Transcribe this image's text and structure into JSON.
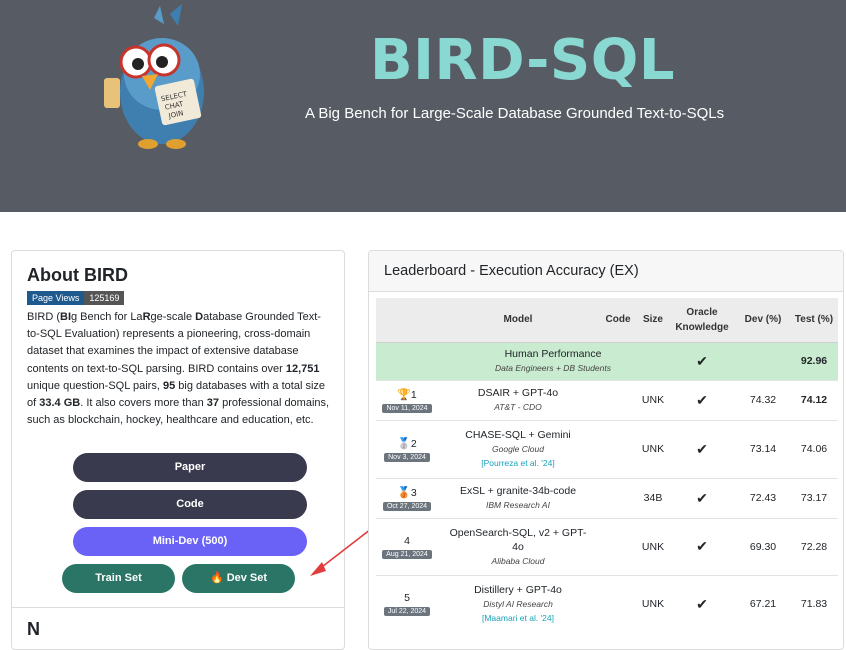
{
  "header": {
    "title": "BIRD-SQL",
    "subtitle": "A Big Bench for Large-Scale Database Grounded Text-to-SQLs",
    "mascot_sign": "SELECT CHAT JOIN"
  },
  "about": {
    "heading": "About BIRD",
    "badge_label": "Page Views",
    "badge_count": "125169",
    "p1": "BIRD (",
    "p1_b1": "BI",
    "p1_a": "g Bench for La",
    "p1_b2": "R",
    "p1_b": "ge-scale ",
    "p1_b3": "D",
    "p1_c": "atabase Grounded Text-to-SQL Evaluation) represents a pioneering, cross-domain dataset that examines the impact of extensive database contents on text-to-SQL parsing. BIRD contains over ",
    "n1": "12,751",
    "p2": " unique question-SQL pairs, ",
    "n2": "95",
    "p3": " big databases with a total size of ",
    "n3": "33.4 GB",
    "p4": ". It also covers more than ",
    "n4": "37",
    "p5": " professional domains, such as blockchain, hockey, healthcare and education, etc.",
    "buttons": {
      "paper": "Paper",
      "code": "Code",
      "minidev": "Mini-Dev (500)",
      "train": "Train Set",
      "dev": "🔥 Dev Set"
    },
    "next_heading": "N"
  },
  "leaderboard": {
    "title": "Leaderboard - Execution Accuracy (EX)",
    "columns": [
      "",
      "Model",
      "Code",
      "Size",
      "Oracle Knowledge",
      "Dev (%)",
      "Test (%)"
    ],
    "human": {
      "name": "Human Performance",
      "org": "Data Engineers + DB Students",
      "oracle": "✔",
      "test": "92.96"
    },
    "rows": [
      {
        "medal": "🏆",
        "rank": "1",
        "date": "Nov 11, 2024",
        "name": "DSAIR + GPT-4o",
        "org": "AT&T - CDO",
        "link": "",
        "code": "",
        "size": "UNK",
        "oracle": "✔",
        "dev": "74.32",
        "test": "74.12"
      },
      {
        "medal": "🥈",
        "rank": "2",
        "date": "Nov 3, 2024",
        "name": "CHASE-SQL + Gemini",
        "org": "Google Cloud",
        "link": "[Pourreza et al. '24]",
        "code": "",
        "size": "UNK",
        "oracle": "✔",
        "dev": "73.14",
        "test": "74.06"
      },
      {
        "medal": "🥉",
        "rank": "3",
        "date": "Oct 27, 2024",
        "name": "ExSL + granite-34b-code",
        "org": "IBM Research AI",
        "link": "",
        "code": "",
        "size": "34B",
        "oracle": "✔",
        "dev": "72.43",
        "test": "73.17"
      },
      {
        "medal": "",
        "rank": "4",
        "date": "Aug 21, 2024",
        "name": "OpenSearch-SQL, v2 + GPT-4o",
        "org": "Alibaba Cloud",
        "link": "",
        "code": "",
        "size": "UNK",
        "oracle": "✔",
        "dev": "69.30",
        "test": "72.28"
      },
      {
        "medal": "",
        "rank": "5",
        "date": "Jul 22, 2024",
        "name": "Distillery + GPT-4o",
        "org": "Distyl AI Research",
        "link": "[Maamari et al. '24]",
        "code": "",
        "size": "UNK",
        "oracle": "✔",
        "dev": "67.21",
        "test": "71.83"
      }
    ]
  },
  "colors": {
    "hero_bg": "#575c64",
    "title": "#8ad8d2",
    "btn_dark": "#3a3a4e",
    "btn_purple": "#6a62f6",
    "btn_teal": "#2a7566",
    "human_row": "#c9ebd0",
    "link": "#17a2b8",
    "arrow": "#e23b3b"
  }
}
